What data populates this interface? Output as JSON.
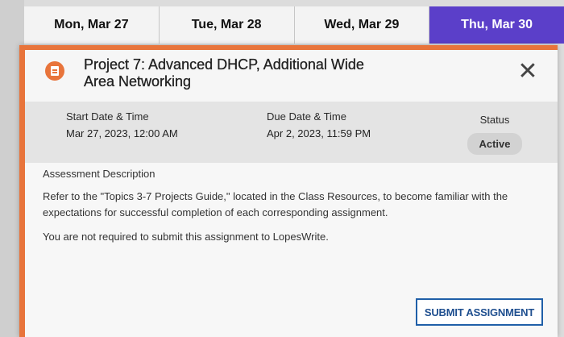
{
  "calendar": {
    "days": [
      {
        "label": "Mon, Mar 27"
      },
      {
        "label": "Tue, Mar 28"
      },
      {
        "label": "Wed, Mar 29"
      },
      {
        "label": "Thu, Mar 30"
      }
    ],
    "active_color": "#5b3fc9"
  },
  "modal": {
    "accent_color": "#e8743b",
    "icon": "document-icon",
    "title": "Project 7: Advanced DHCP, Additional Wide Area Networking",
    "close_icon": "close-icon",
    "start": {
      "label": "Start Date & Time",
      "value": "Mar 27, 2023, 12:00 AM"
    },
    "due": {
      "label": "Due Date & Time",
      "value": "Apr 2, 2023, 11:59 PM"
    },
    "status": {
      "label": "Status",
      "value": "Active"
    },
    "description_label": "Assessment Description",
    "paragraphs": [
      "Refer to the \"Topics 3-7 Projects Guide,\" located in the Class Resources, to become familiar with the expectations for successful completion of each corresponding assignment.",
      "You are not required to submit this assignment to LopesWrite."
    ],
    "submit_label": "SUBMIT ASSIGNMENT"
  }
}
